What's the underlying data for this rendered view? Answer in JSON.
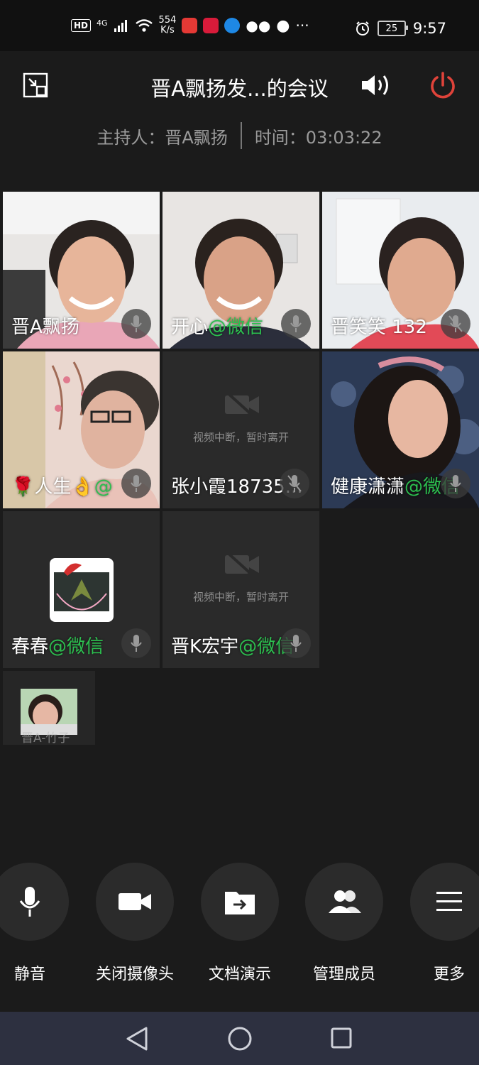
{
  "status_bar": {
    "hd": "HD",
    "signal": "4G",
    "net_speed_value": "554",
    "net_speed_unit": "K/s",
    "more": "···",
    "battery": "25",
    "time": "9:57"
  },
  "header": {
    "title": "晋A飘扬发...的会议",
    "host_label": "主持人：晋A飘扬",
    "time_label": "时间：03:03:22"
  },
  "participants": [
    {
      "name": "晋A飘扬",
      "suffix": ""
    },
    {
      "name": "开心",
      "suffix": "@微信"
    },
    {
      "name": "晋笑笑 132",
      "suffix": ""
    },
    {
      "name": "🌹人生👌",
      "suffix": "@"
    },
    {
      "name": "张小霞18735...",
      "suffix": "",
      "placeholder": "视频中断，暂时离开"
    },
    {
      "name": "健康潇潇",
      "suffix": "@微信"
    },
    {
      "name": "春春",
      "suffix": "@微信"
    },
    {
      "name": "晋K宏宇",
      "suffix": "@微信",
      "placeholder": "视频中断，暂时离开"
    },
    {
      "name": "晋A-竹子",
      "suffix": ""
    }
  ],
  "toolbar": {
    "mute": "静音",
    "camera_off": "关闭摄像头",
    "share_doc": "文档演示",
    "manage_members": "管理成员",
    "more": "更多"
  },
  "colors": {
    "wechat_green": "#2cc04f",
    "power_red": "#e0433a",
    "background": "#1b1b1b"
  }
}
